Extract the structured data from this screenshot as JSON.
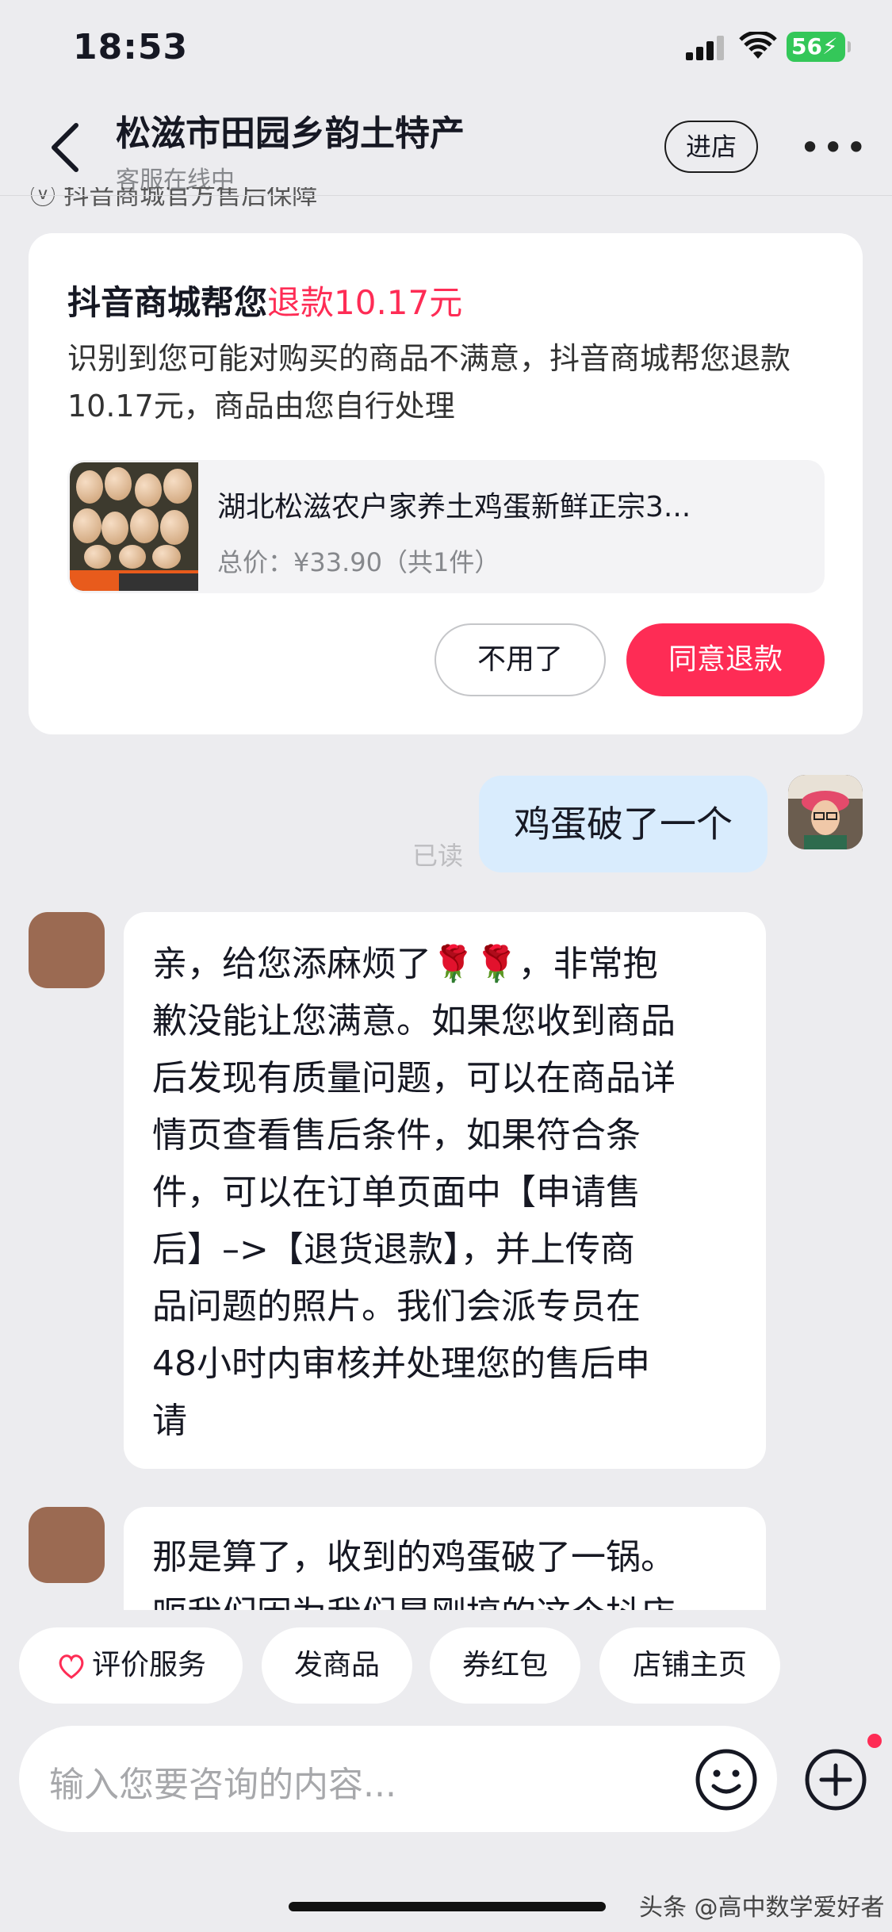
{
  "status_bar": {
    "time": "18:53",
    "battery": "56"
  },
  "header": {
    "title": "松滋市田园乡韵土特产",
    "status": "客服在线中",
    "enter_store": "进店",
    "more": "•••",
    "peek_text": "抖音商城官方售后保障"
  },
  "refund_card": {
    "title_prefix": "抖音商城帮您",
    "title_highlight": "退款10.17元",
    "description": "识别到您可能对购买的商品不满意，抖音商城帮您退款10.17元，商品由您自行处理",
    "product": {
      "name": "湖北松滋农户家养土鸡蛋新鲜正宗3...",
      "price": "总价：¥33.90（共1件）"
    },
    "decline_button": "不用了",
    "accept_button": "同意退款"
  },
  "messages": [
    {
      "from": "user",
      "text": "鸡蛋破了一个",
      "status": "已读"
    },
    {
      "from": "shop",
      "lines": [
        "亲，给您添麻烦了🌹🌹，非常抱",
        "歉没能让您满意。如果您收到商品",
        "后发现有质量问题，可以在商品详",
        "情页查看售后条件，如果符合条",
        "件，可以在订单页面中【申请售",
        "后】–>【退货退款】，并上传商",
        "品问题的照片。我们会派专员在",
        "48小时内审核并处理您的售后申",
        "请"
      ]
    },
    {
      "from": "user_reply",
      "lines": [
        "那是算了，收到的鸡蛋破了一锅。",
        "呃我们因为我们是刚搞的这个抖店"
      ]
    }
  ],
  "quick_actions": [
    "评价服务",
    "发商品",
    "券红包",
    "店铺主页"
  ],
  "input": {
    "placeholder": "输入您要咨询的内容..."
  },
  "colors": {
    "accent": "#fe2c55",
    "user_bubble": "#d9ecfd",
    "background": "#ececef"
  },
  "watermark": "头条 @高中数学爱好者"
}
